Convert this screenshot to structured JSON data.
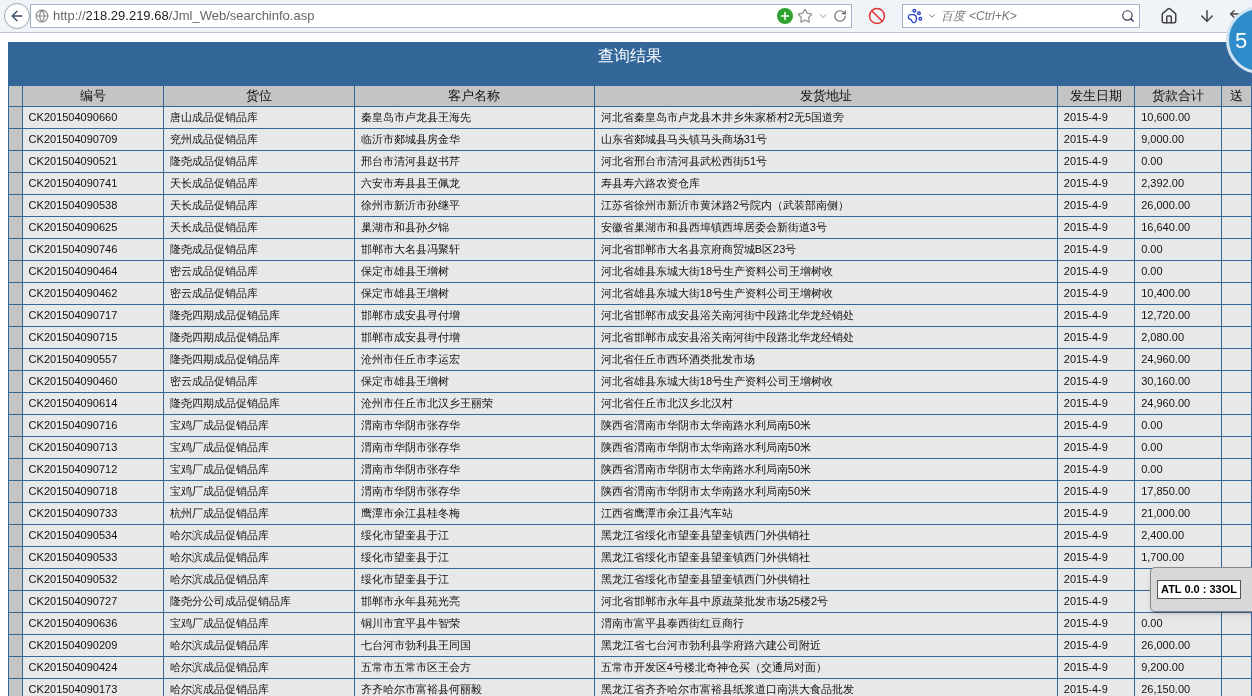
{
  "browser": {
    "url": "http://**218.29.219.68**/Jml_Web/searchinfo.asp",
    "search_engine": "百度",
    "search_placeholder": "<Ctrl+K>"
  },
  "badge": "5",
  "page": {
    "title": "查询结果",
    "columns": [
      "编号",
      "货位",
      "客户名称",
      "发货地址",
      "发生日期",
      "货款合计",
      "送"
    ],
    "rows": [
      [
        "CK201504090660",
        "唐山成品促销品库",
        "秦皇岛市卢龙县王海先",
        "河北省秦皇岛市卢龙县木井乡朱家桥村2无5国道旁",
        "2015-4-9",
        "10,600.00"
      ],
      [
        "CK201504090709",
        "兖州成品促销品库",
        "临沂市郯城县房金华",
        "山东省郯城县马头镇马头商场31号",
        "2015-4-9",
        "9,000.00"
      ],
      [
        "CK201504090521",
        "隆尧成品促销品库",
        "邢台市清河县赵书芹",
        "河北省邢台市清河县武松西街51号",
        "2015-4-9",
        "0.00"
      ],
      [
        "CK201504090741",
        "天长成品促销品库",
        "六安市寿县县王佩龙",
        "寿县寿六路农资仓库",
        "2015-4-9",
        "2,392.00"
      ],
      [
        "CK201504090538",
        "天长成品促销品库",
        "徐州市新沂市孙继平",
        "江苏省徐州市新沂市黄沭路2号院内（武装部南侧）",
        "2015-4-9",
        "26,000.00"
      ],
      [
        "CK201504090625",
        "天长成品促销品库",
        "巢湖市和县孙夕锦",
        "安徽省巢湖市和县西埠镇西埠居委会新街道3号",
        "2015-4-9",
        "16,640.00"
      ],
      [
        "CK201504090746",
        "隆尧成品促销品库",
        "邯郸市大名县冯聚轩",
        "河北省邯郸市大名县京府商贸城B区23号",
        "2015-4-9",
        "0.00"
      ],
      [
        "CK201504090464",
        "密云成品促销品库",
        "保定市雄县王增树",
        "河北省雄县东城大街18号生产资料公司王增树收",
        "2015-4-9",
        "0.00"
      ],
      [
        "CK201504090462",
        "密云成品促销品库",
        "保定市雄县王增树",
        "河北省雄县东城大街18号生产资料公司王增树收",
        "2015-4-9",
        "10,400.00"
      ],
      [
        "CK201504090717",
        "隆尧四期成品促销品库",
        "邯郸市成安县寻付增",
        "河北省邯郸市成安县浴关南河街中段路北华龙经销处",
        "2015-4-9",
        "12,720.00"
      ],
      [
        "CK201504090715",
        "隆尧四期成品促销品库",
        "邯郸市成安县寻付增",
        "河北省邯郸市成安县浴关南河街中段路北华龙经销处",
        "2015-4-9",
        "2,080.00"
      ],
      [
        "CK201504090557",
        "隆尧四期成品促销品库",
        "沧州市任丘市李运宏",
        "河北省任丘市西环酒类批发市场",
        "2015-4-9",
        "24,960.00"
      ],
      [
        "CK201504090460",
        "密云成品促销品库",
        "保定市雄县王增树",
        "河北省雄县东城大街18号生产资料公司王增树收",
        "2015-4-9",
        "30,160.00"
      ],
      [
        "CK201504090614",
        "隆尧四期成品促销品库",
        "沧州市任丘市北汉乡王丽荣",
        "河北省任丘市北汉乡北汉村",
        "2015-4-9",
        "24,960.00"
      ],
      [
        "CK201504090716",
        "宝鸡厂成品促销品库",
        "渭南市华阴市张存华",
        "陕西省渭南市华阴市太华南路水利局南50米",
        "2015-4-9",
        "0.00"
      ],
      [
        "CK201504090713",
        "宝鸡厂成品促销品库",
        "渭南市华阴市张存华",
        "陕西省渭南市华阴市太华南路水利局南50米",
        "2015-4-9",
        "0.00"
      ],
      [
        "CK201504090712",
        "宝鸡厂成品促销品库",
        "渭南市华阴市张存华",
        "陕西省渭南市华阴市太华南路水利局南50米",
        "2015-4-9",
        "0.00"
      ],
      [
        "CK201504090718",
        "宝鸡厂成品促销品库",
        "渭南市华阴市张存华",
        "陕西省渭南市华阴市太华南路水利局南50米",
        "2015-4-9",
        "17,850.00"
      ],
      [
        "CK201504090733",
        "杭州厂成品促销品库",
        "鹰潭市余江县桂冬梅",
        "江西省鹰潭市余江县汽车站",
        "2015-4-9",
        "21,000.00"
      ],
      [
        "CK201504090534",
        "哈尔滨成品促销品库",
        "绥化市望奎县于江",
        "黑龙江省绥化市望奎县望奎镇西门外供销社",
        "2015-4-9",
        "2,400.00"
      ],
      [
        "CK201504090533",
        "哈尔滨成品促销品库",
        "绥化市望奎县于江",
        "黑龙江省绥化市望奎县望奎镇西门外供销社",
        "2015-4-9",
        "1,700.00"
      ],
      [
        "CK201504090532",
        "哈尔滨成品促销品库",
        "绥化市望奎县于江",
        "黑龙江省绥化市望奎县望奎镇西门外供销社",
        "2015-4-9"
      ],
      [
        "CK201504090727",
        "隆尧分公司成品促销品库",
        "邯郸市永年县苑光亮",
        "河北省邯郸市永年县中原蔬菜批发市场25楼2号",
        "2015-4-9"
      ],
      [
        "CK201504090636",
        "宝鸡厂成品促销品库",
        "铜川市宜平县牛智荣",
        "渭南市富平县泰西街红豆商行",
        "2015-4-9",
        "0.00"
      ],
      [
        "CK201504090209",
        "哈尔滨成品促销品库",
        "七台河市勃利县王同国",
        "黑龙江省七台河市勃利县学府路六建公司附近",
        "2015-4-9",
        "26,000.00"
      ],
      [
        "CK201504090424",
        "哈尔滨成品促销品库",
        "五常市五常市区王会方",
        "五常市开发区4号楼北奇神仓买（交通局对面）",
        "2015-4-9",
        "9,200.00"
      ],
      [
        "CK201504090173",
        "哈尔滨成品促销品库",
        "齐齐哈尔市富裕县何丽毅",
        "黑龙江省齐齐哈尔市富裕县纸浆道口南洪大食品批发",
        "2015-4-9",
        "26,150.00"
      ]
    ]
  },
  "popup": {
    "text": "ATL 0.0 : 33OL"
  }
}
